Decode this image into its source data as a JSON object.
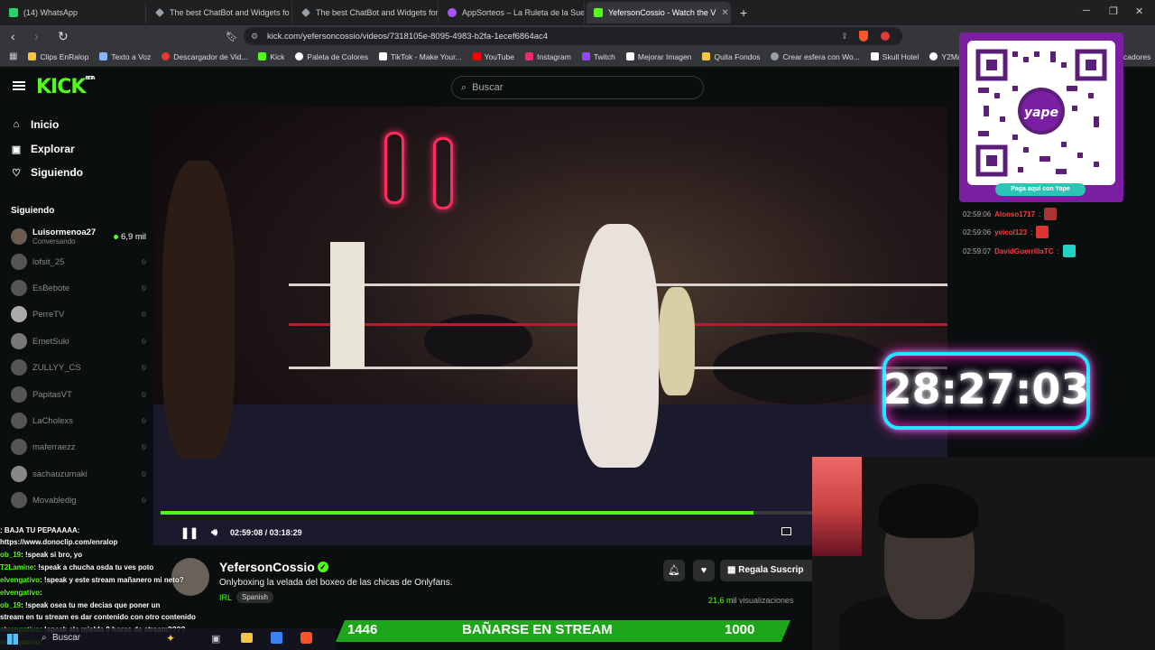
{
  "browser": {
    "tabs": [
      {
        "label": "(14) WhatsApp",
        "color": "#25d366"
      },
      {
        "label": "The best ChatBot and Widgets fo",
        "color": "#9aa0a6"
      },
      {
        "label": "The best ChatBot and Widgets for Ki",
        "color": "#9aa0a6"
      },
      {
        "label": "AppSorteos – La Ruleta de la Suerte",
        "color": "#a855f7"
      },
      {
        "label": "YefersonCossio - Watch the V",
        "color": "#53fc18"
      }
    ],
    "url": "kick.com/yefersoncossio/videos/7318105e-8095-4983-b2fa-1ecef6864ac4",
    "bookmarks": [
      {
        "label": "Clips EnRalop",
        "color": "#f4c542"
      },
      {
        "label": "Texto a Voz",
        "color": "#8ab4f8"
      },
      {
        "label": "Descargador de Vid...",
        "color": "#e53935"
      },
      {
        "label": "Kick",
        "color": "#53fc18"
      },
      {
        "label": "Paleta de Colores",
        "color": "#ffffff"
      },
      {
        "label": "TikTok - Make Your...",
        "color": "#ffffff"
      },
      {
        "label": "YouTube",
        "color": "#ff0000"
      },
      {
        "label": "Instagram",
        "color": "#e1306c"
      },
      {
        "label": "Twitch",
        "color": "#9146ff"
      },
      {
        "label": "Mejorar Imagen",
        "color": "#ffffff"
      },
      {
        "label": "Quita Fondos",
        "color": "#f4c542"
      },
      {
        "label": "Crear esfera con Wo...",
        "color": "#9aa0a6"
      },
      {
        "label": "Skull Hotel",
        "color": "#ffffff"
      },
      {
        "label": "Y2Mate - Conv",
        "color": "#ffffff"
      }
    ],
    "bookmarks_extra": "cadores"
  },
  "kick": {
    "logo": "KICK",
    "logo_sup": "BETA",
    "search_placeholder": "Buscar",
    "nav": [
      "Inicio",
      "Explorar",
      "Siguiendo"
    ],
    "following_header": "Siguiendo",
    "following": [
      {
        "name": "Luisormenoa27",
        "sub": "Conversando",
        "viewers": "6,9 mil",
        "live": true
      },
      {
        "name": "lofsit_25"
      },
      {
        "name": "EsBebote"
      },
      {
        "name": "PerreTV"
      },
      {
        "name": "EmetSuki"
      },
      {
        "name": "ZULLYY_CS"
      },
      {
        "name": "PapitasVT"
      },
      {
        "name": "LaCholexs"
      },
      {
        "name": "maferraezz"
      },
      {
        "name": "sachauzumaki"
      },
      {
        "name": "Movabledig"
      }
    ]
  },
  "player": {
    "time": "02:59:08 / 03:18:29",
    "progress_fraction": 0.91
  },
  "stream": {
    "streamer": "YefersonCossio",
    "title": "Onlyboxing la velada del boxeo de las chicas de Onlyfans.",
    "category": "IRL",
    "tag": "Spanish",
    "gift": "Regala Suscrip",
    "views_count": "21,6 mil",
    "views_label": "visualizaciones"
  },
  "chat_overlay": [
    {
      "user": "",
      "text": ": BAJA TU PEPAAAAA:"
    },
    {
      "user": "",
      "text": "https://www.donoclip.com/enralop"
    },
    {
      "user": "ob_19",
      "text": ": !speak si bro, yo"
    },
    {
      "user": "T2Lamine",
      "text": ": !speak a chucha osda tu ves poto"
    },
    {
      "user": "elvengativo",
      "text": ": !speak y este stream mañanero mi neto?"
    },
    {
      "user": "elvengativo",
      "text": ":"
    },
    {
      "user": "ob_19",
      "text": ": !speak osea tu me decias que poner un"
    },
    {
      "user": "",
      "text": "stream en tu stream es dar contenido con otro contenido"
    },
    {
      "user": "elvengativo",
      "text": ": !speak ala mielda 9 horas de stream????"
    },
    {
      "user": "elvengativo",
      "text": ":"
    }
  ],
  "right_chat": [
    {
      "time": "02:59:06",
      "user": "Alonso1717"
    },
    {
      "time": "02:59:06",
      "user": "yeicol123"
    },
    {
      "time": "02:59:07",
      "user": "DavidGuerrillaTC"
    }
  ],
  "qr": {
    "brand": "yape",
    "button": "Paga aquí con Yape"
  },
  "timer": "28:27:03",
  "banner": {
    "left": "1446",
    "center": "BAÑARSE EN STREAM",
    "right": "1000"
  },
  "taskbar": {
    "search": "Buscar"
  }
}
